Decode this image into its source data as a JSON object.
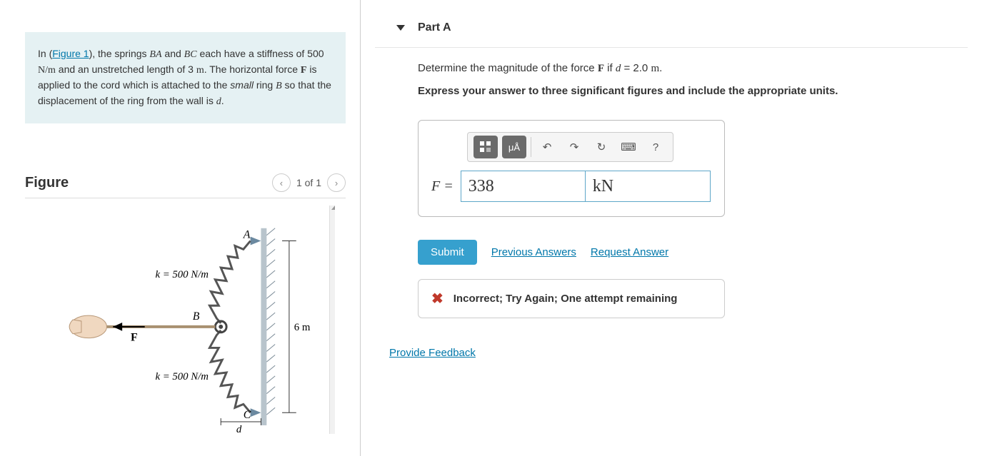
{
  "problem": {
    "text_prefix": "In (",
    "figure_link": "Figure 1",
    "text_body1": "), the springs ",
    "var_BA": "BA",
    "text_body2": " and ",
    "var_BC": "BC",
    "text_body3": " each have a stiffness of 500 ",
    "unit_Nm": "N/m",
    "text_body4": " and an unstretched length of 3 ",
    "unit_m": "m",
    "text_body5": ". The horizontal force ",
    "var_F": "F",
    "text_body6": " is applied to the cord which is attached to the ",
    "em_small": "small",
    "text_body7": " ring ",
    "var_B": "B",
    "text_body8": " so that the displacement of the ring from the wall is ",
    "var_d": "d",
    "text_body9": "."
  },
  "figure": {
    "title": "Figure",
    "pager": "1 of 1",
    "label_k_top": "k = 500 N/m",
    "label_k_bot": "k = 500 N/m",
    "label_A": "A",
    "label_B": "B",
    "label_C": "C",
    "label_F": "F",
    "label_6m": "6 m",
    "label_d": "d"
  },
  "partA": {
    "header": "Part A",
    "question_pre": "Determine the magnitude of the force ",
    "question_F": "F",
    "question_mid": " if ",
    "question_d": "d",
    "question_post": " = 2.0 ",
    "question_unit": "m",
    "question_end": ".",
    "instruction": "Express your answer to three significant figures and include the appropriate units.",
    "answer_label": "F =",
    "value": "338",
    "unit": "kN",
    "toolbar": {
      "templates": "templates",
      "units_sym": "μÅ",
      "undo": "↶",
      "redo": "↷",
      "reset": "↻",
      "keyboard": "⌨",
      "help": "?"
    },
    "submit": "Submit",
    "prev_answers": "Previous Answers",
    "request_answer": "Request Answer",
    "feedback": "Incorrect; Try Again; One attempt remaining"
  },
  "footer": {
    "provide_feedback": "Provide Feedback"
  }
}
